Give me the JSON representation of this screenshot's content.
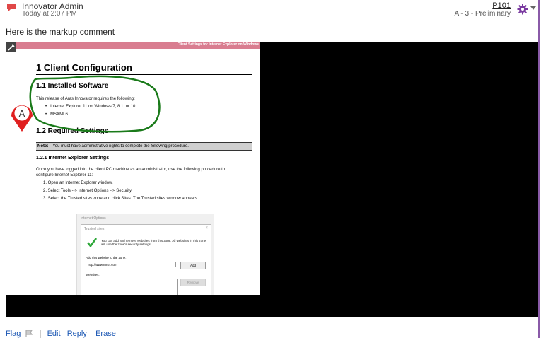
{
  "header": {
    "author": "Innovator Admin",
    "timestamp": "Today at 2:07 PM",
    "doc_ref": "P101",
    "revision": "A - 3 - Preliminary",
    "avatar_icon": "speech-bubble-icon",
    "settings_icon": "gear-icon"
  },
  "comment_text": "Here is the markup comment",
  "document": {
    "header_bar": "Client Settings for Internet Explorer on Windows",
    "h1": "1  Client Configuration",
    "h2_installed": "1.1  Installed Software",
    "installed_intro": "This release of Aras Innovator requires the following:",
    "installed_items": [
      "Internet Explorer 11 on Windows 7, 8.1, or 10.",
      "MSXML6."
    ],
    "h2_required": "1.2  Required Settings",
    "note_label": "Note:",
    "note_text": "You must have administrative rights to complete the following procedure.",
    "h3": "1.2.1   Internet Explorer Settings",
    "procedure_intro_1": "Once you have logged into the client PC machine as an administrator, use the following procedure to",
    "procedure_intro_2": "configure Internet Explorer 11:",
    "steps": [
      "1.    Open an Internet Explorer window.",
      "2.    Select Tools --> Internet Options --> Security.",
      "3.    Select the Trusted sites zone and click Sites. The Trusted sites window appears."
    ],
    "dialog": {
      "outer_title": "Internet Options",
      "inner_title": "Trusted sites",
      "close": "×",
      "info": "You can add and remove websites from this zone. All websites in this zone will use the zone's security settings.",
      "add_label": "Add this website to the zone:",
      "url_value": "http://www.mrsn.com",
      "add_button": "Add",
      "websites_label": "Websites:",
      "remove_button": "Remove"
    }
  },
  "markup": {
    "callout_label": "A",
    "callout_color": "#e02020",
    "outline_color": "#1a7a1a"
  },
  "footer": {
    "flag": "Flag",
    "edit": "Edit",
    "reply": "Reply",
    "erase": "Erase"
  },
  "colors": {
    "accent": "#8a5aa8",
    "link": "#1a56b3",
    "doc_header": "#d97d90"
  }
}
